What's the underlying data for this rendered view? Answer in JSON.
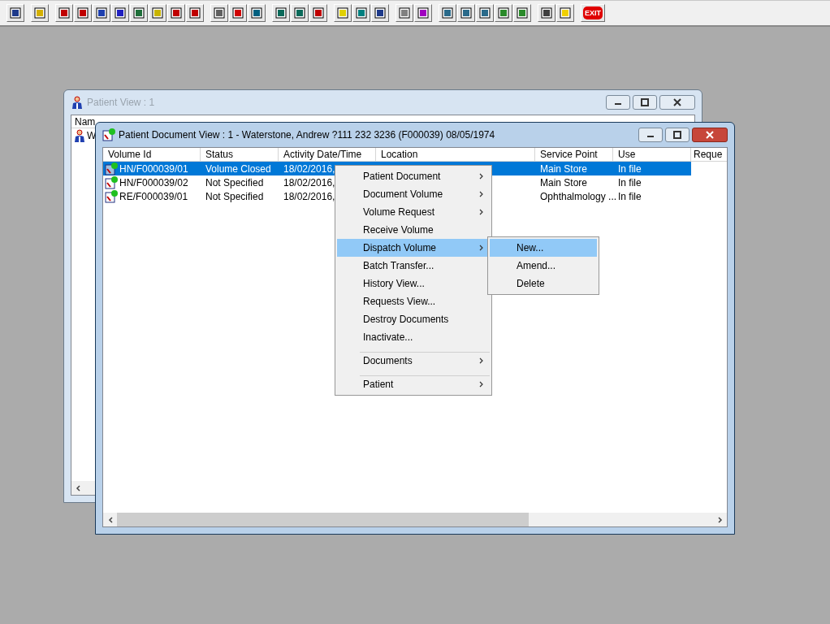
{
  "toolbar": {
    "exit_label": "EXIT"
  },
  "patient_view": {
    "title": "Patient View : 1",
    "active": false,
    "columns": [
      "Nam"
    ],
    "rows": [
      {
        "cells": [
          "W"
        ]
      }
    ]
  },
  "document_view": {
    "title": "Patient Document View : 1 - Waterstone, Andrew ?111 232 3236 (F000039) 08/05/1974",
    "active": true,
    "columns": [
      "Volume Id",
      "Status",
      "Activity Date/Time",
      "Location",
      "Service Point",
      "Use",
      "Reque"
    ],
    "rows": [
      {
        "cells": [
          "HN/F000039/01",
          "Volume Closed",
          "18/02/2016,",
          "",
          "Main Store",
          "In file"
        ],
        "selected": true
      },
      {
        "cells": [
          "HN/F000039/02",
          "Not Specified",
          "18/02/2016,",
          "",
          "Main Store",
          "In file"
        ],
        "selected": false
      },
      {
        "cells": [
          "RE/F000039/01",
          "Not Specified",
          "18/02/2016,",
          "",
          "Ophthalmology ...",
          "In file"
        ],
        "selected": false
      }
    ]
  },
  "context_menu": {
    "items": [
      {
        "label": "Patient Document",
        "submenu": true,
        "selected": false,
        "divider_before": false
      },
      {
        "label": "Document Volume",
        "submenu": true,
        "selected": false,
        "divider_before": false
      },
      {
        "label": "Volume Request",
        "submenu": true,
        "selected": false,
        "divider_before": false
      },
      {
        "label": "Receive Volume",
        "submenu": false,
        "selected": false,
        "divider_before": false
      },
      {
        "label": "Dispatch Volume",
        "submenu": true,
        "selected": true,
        "divider_before": false
      },
      {
        "label": "Batch Transfer...",
        "submenu": false,
        "selected": false,
        "divider_before": false
      },
      {
        "label": "History View...",
        "submenu": false,
        "selected": false,
        "divider_before": false
      },
      {
        "label": "Requests View...",
        "submenu": false,
        "selected": false,
        "divider_before": false
      },
      {
        "label": "Destroy Documents",
        "submenu": false,
        "selected": false,
        "divider_before": false
      },
      {
        "label": "Inactivate...",
        "submenu": false,
        "selected": false,
        "divider_before": false
      },
      {
        "label": "Documents",
        "submenu": true,
        "selected": false,
        "divider_before": true
      },
      {
        "label": "Patient",
        "submenu": true,
        "selected": false,
        "divider_before": true
      }
    ]
  },
  "submenu": {
    "items": [
      {
        "label": "New...",
        "selected": true
      },
      {
        "label": "Amend...",
        "selected": false
      },
      {
        "label": "Delete",
        "selected": false
      }
    ]
  }
}
